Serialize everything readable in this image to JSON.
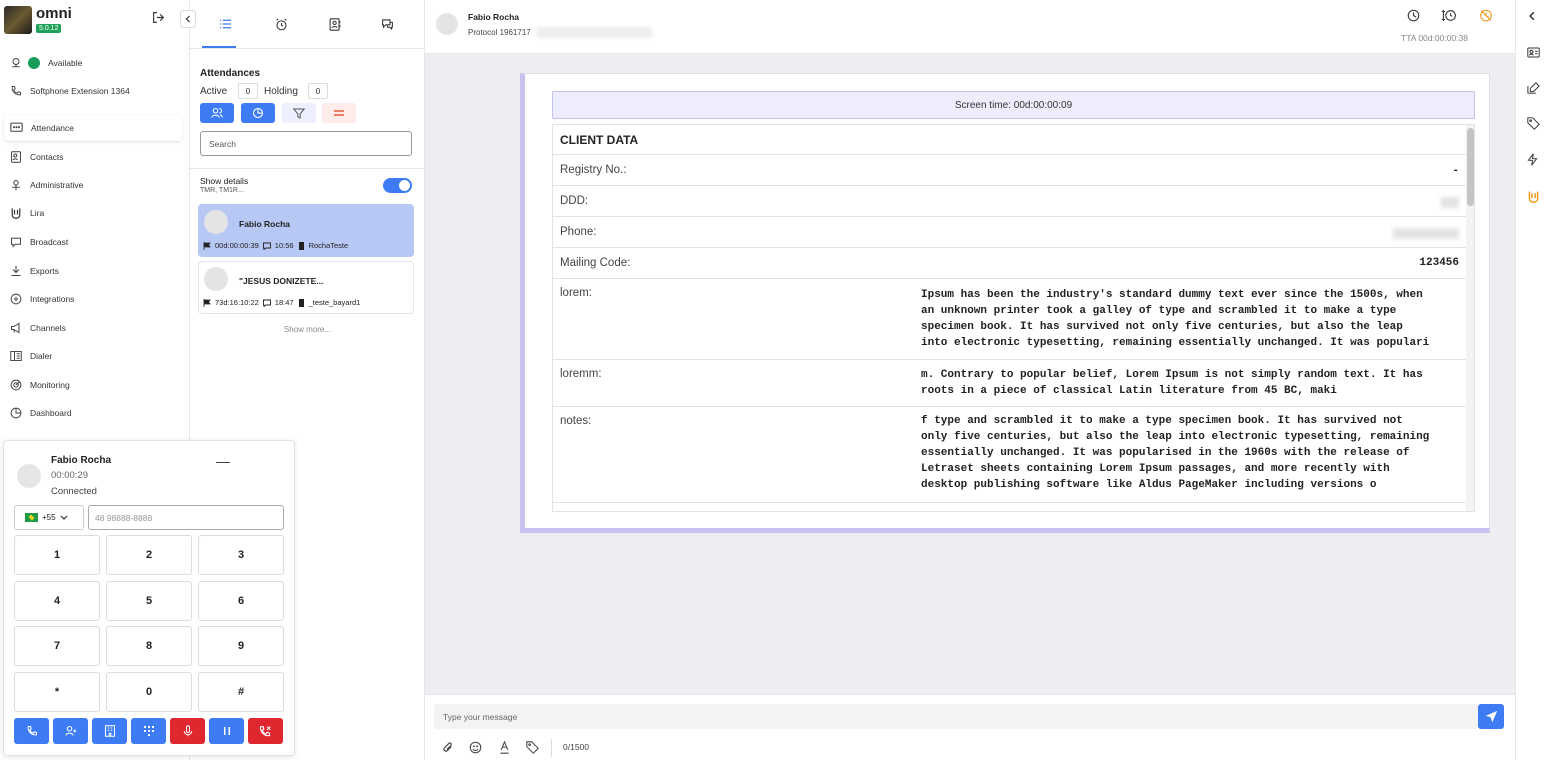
{
  "app": {
    "name": "omni",
    "version": "5.0.12"
  },
  "sidebar": {
    "status": "Available",
    "softphone": "Softphone Extension 1364",
    "items": [
      {
        "label": "Attendance",
        "icon": "chat-dots-icon"
      },
      {
        "label": "Contacts",
        "icon": "contact-card-icon"
      },
      {
        "label": "Administrative",
        "icon": "admin-icon"
      },
      {
        "label": "Lira",
        "icon": "lira-icon"
      },
      {
        "label": "Broadcast",
        "icon": "broadcast-icon"
      },
      {
        "label": "Exports",
        "icon": "download-icon"
      },
      {
        "label": "Integrations",
        "icon": "integrations-icon"
      },
      {
        "label": "Channels",
        "icon": "megaphone-icon"
      },
      {
        "label": "Dialer",
        "icon": "dialer-icon"
      },
      {
        "label": "Monitoring",
        "icon": "monitoring-icon"
      },
      {
        "label": "Dashboard",
        "icon": "dashboard-icon"
      }
    ]
  },
  "softphone": {
    "name": "Fabio Rocha",
    "duration": "00:00:29",
    "status": "Connected",
    "country_code": "+55",
    "number_placeholder": "48 98888-8888",
    "keys": [
      "1",
      "2",
      "3",
      "4",
      "5",
      "6",
      "7",
      "8",
      "9",
      "*",
      "0",
      "#"
    ]
  },
  "attendances": {
    "title": "Attendances",
    "active_label": "Active",
    "active_count": "0",
    "holding_label": "Holding",
    "holding_count": "0",
    "search_placeholder": "Search",
    "show_details_label": "Show details",
    "show_details_sub": "TMR, TM1R...",
    "show_details_on": true,
    "cards": [
      {
        "name": "Fabio Rocha",
        "timer": "00d:00:00:39",
        "time": "10:56",
        "queue": "RochaTeste"
      },
      {
        "name": "\"JESUS DONIZETE...",
        "timer": "73d:16:10:22",
        "time": "18:47",
        "queue": "_teste_bayard1"
      }
    ],
    "show_more": "Show more..."
  },
  "chat_header": {
    "name": "Fabio Rocha",
    "protocol": "Protocol 1961717",
    "tta": "TTA 00d:00:00:38"
  },
  "client_data": {
    "screen_time": "Screen time: 00d:00:00:09",
    "title": "CLIENT DATA",
    "rows": [
      {
        "label": "Registry No.:",
        "value": "-"
      },
      {
        "label": "DDD:",
        "value": ""
      },
      {
        "label": "Phone:",
        "value": ""
      },
      {
        "label": "Mailing Code:",
        "value": "123456"
      },
      {
        "label": "lorem:",
        "value": "Ipsum has been the industry's standard dummy text ever since the 1500s, when\nan unknown printer took a galley of type and scrambled it to make a type\nspecimen book. It has survived not only five centuries, but also the leap\ninto electronic typesetting, remaining essentially unchanged. It was populari"
      },
      {
        "label": "loremm:",
        "value": "m. Contrary to popular belief, Lorem Ipsum is not simply random text. It has\nroots in a piece of classical Latin literature from 45 BC, maki"
      },
      {
        "label": "notes:",
        "value": "f type and scrambled it to make a type specimen book. It has survived not\nonly five centuries, but also the leap into electronic typesetting, remaining\nessentially unchanged. It was popularised in the 1960s with the release of\nLetraset sheets containing Lorem Ipsum passages, and more recently with\ndesktop publishing software like Aldus PageMaker including versions o"
      }
    ]
  },
  "composer": {
    "placeholder": "Type your message",
    "char_count": "0/1500"
  },
  "colors": {
    "accent": "#3d7cf4",
    "danger": "#e0262f",
    "status_online": "#179b5a",
    "selected_card": "#b8c8f5"
  }
}
